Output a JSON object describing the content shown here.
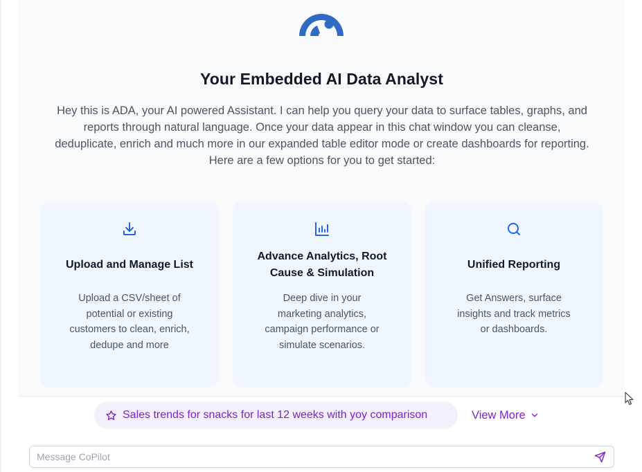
{
  "header": {
    "title": "Your Embedded AI Data Analyst",
    "intro": "Hey this is ADA, your AI powered Assistant. I can help you query your data to surface tables, graphs, and reports through natural language. Once your data appear in this chat window you can cleanse, deduplicate, enrich and much more in our expanded table editor mode or create dashboards for reporting. Here are a few options for you to get started:"
  },
  "cards": [
    {
      "icon": "download-icon",
      "title": "Upload and Manage List",
      "description": "Upload a CSV/sheet of potential or existing customers to clean, enrich, dedupe and more"
    },
    {
      "icon": "bar-chart-icon",
      "title": "Advance Analytics, Root Cause & Simulation",
      "description": "Deep dive in your marketing analytics, campaign performance or simulate scenarios."
    },
    {
      "icon": "search-icon",
      "title": "Unified Reporting",
      "description": "Get Answers, surface insights and track metrics or dashboards."
    }
  ],
  "suggestion": {
    "icon": "star-icon",
    "text": "Sales trends for snacks for last 12 weeks with yoy comparison"
  },
  "view_more": {
    "label": "View More",
    "icon": "chevron-down-icon"
  },
  "message": {
    "placeholder": "Message CoPilot",
    "value": "",
    "send_icon": "send-icon"
  },
  "colors": {
    "accent_blue": "#2563eb",
    "logo_blue": "#2f6bc4",
    "suggestion_purple": "#7e22ce",
    "card_bg": "#eff6ff"
  }
}
